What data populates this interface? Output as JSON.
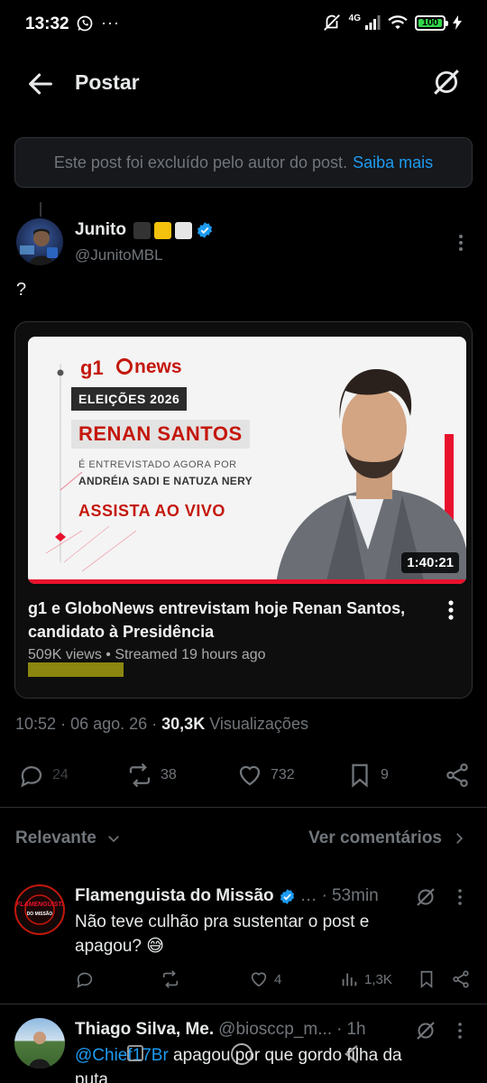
{
  "status_bar": {
    "time": "13:32",
    "network": "4G",
    "battery": "100"
  },
  "header": {
    "title": "Postar"
  },
  "deleted_notice": {
    "text": "Este post foi excluído pelo autor do post.",
    "link": "Saiba mais"
  },
  "post": {
    "author_name": "Junito",
    "author_handle": "@JunitoMBL",
    "text": "?",
    "verified_color": "#1d9bf0",
    "video": {
      "channel_logo": "g1",
      "network_logo": "news",
      "tag": "ELEIÇÕES 2026",
      "candidate": "RENAN SANTOS",
      "subtitle1": "É ENTREVISTADO  AGORA POR",
      "subtitle2": "ANDRÉIA SADI E NATUZA NERY",
      "cta": "ASSISTA AO VIVO",
      "duration": "1:40:21",
      "title": "g1 e GloboNews entrevistam hoje Renan Santos, candidato à Presidência",
      "meta": "509K views • Streamed 19 hours ago"
    },
    "time": "10:52",
    "date": "06 ago. 26",
    "views_count": "30,3K",
    "views_label": "Visualizações",
    "stats": {
      "replies": "24",
      "reposts": "38",
      "likes": "732",
      "bookmarks": "9"
    }
  },
  "sort": {
    "left": "Relevante",
    "right": "Ver comentários"
  },
  "replies": [
    {
      "name": "Flamenguista do Missão",
      "handle": "…",
      "time": "53min",
      "text": "Não teve culhão pra sustentar o post e apagou? 😅",
      "avatar_text": "FLAMENGUISTA",
      "avatar_subtext": "DO MISSÃO",
      "likes": "4",
      "views": "1,3K"
    },
    {
      "name": "Thiago Silva, Me.",
      "handle": "@bioscсp_m...",
      "time": "1h",
      "mention": "@Chief17Br",
      "text": " apagou por que gordo filha da puta"
    }
  ]
}
